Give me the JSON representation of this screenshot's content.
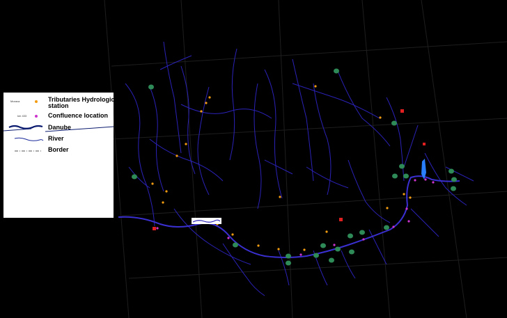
{
  "legend": {
    "items": [
      {
        "symbol": "tributary-station",
        "small_text": "Morava",
        "label_line1": "Tributaries Hydrologic",
        "label_line2": "station",
        "color": "#f39c12"
      },
      {
        "symbol": "confluence",
        "small_text": "km 433",
        "label": "Confluence location",
        "color": "#cc33cc"
      },
      {
        "symbol": "danube",
        "label": "Danube",
        "color": "#0a1a6e"
      },
      {
        "symbol": "river",
        "label": "River",
        "color": "#1a2a9a"
      },
      {
        "symbol": "border",
        "label": "Border",
        "color": "#555555"
      }
    ]
  },
  "colors": {
    "background": "#000000",
    "river": "#2b22b8",
    "danube": "#3a2fd0",
    "grid": "#222222",
    "station_green": "#2e8b57",
    "station_red": "#e02020",
    "station_orange": "#f39c12",
    "confluence_magenta": "#cc33cc",
    "delta_blue": "#2a7fff"
  }
}
